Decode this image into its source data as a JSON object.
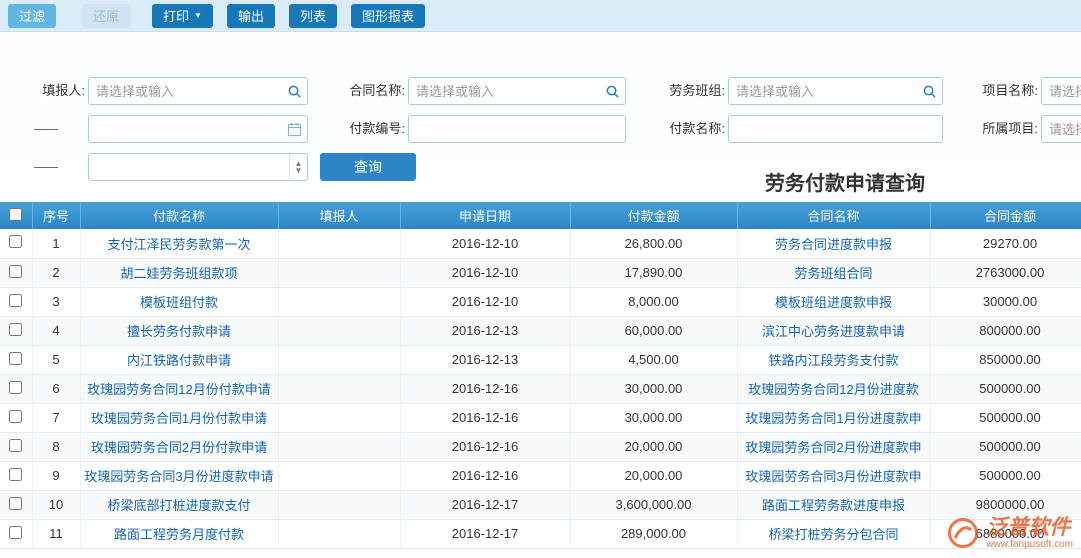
{
  "toolbar": {
    "filter": "过滤",
    "restore": "还原",
    "print": "打印",
    "print_caret": "▼",
    "output": "输出",
    "list": "列表",
    "chart_report": "图形报表"
  },
  "filters": {
    "reporter": {
      "label": "填报人:",
      "placeholder": "请选择或输入"
    },
    "contract": {
      "label": "合同名称:",
      "placeholder": "请选择或输入"
    },
    "team": {
      "label": "劳务班组:",
      "placeholder": "请选择或输入"
    },
    "project": {
      "label": "项目名称:",
      "placeholder": "请选择或输入"
    },
    "date_dash": "——",
    "pay_no": {
      "label": "付款编号:"
    },
    "pay_name": {
      "label": "付款名称:"
    },
    "belong_project": {
      "label": "所属项目:",
      "placeholder": "请选择或输入"
    },
    "num_dash": "——",
    "query": "查询"
  },
  "title": "劳务付款申请查询",
  "table": {
    "headers": [
      "序号",
      "付款名称",
      "填报人",
      "申请日期",
      "付款金额",
      "合同名称",
      "合同金额"
    ],
    "rows": [
      {
        "no": "1",
        "payment_name": "支付江泽民劳务款第一次",
        "reporter": "",
        "date": "2016-12-10",
        "amount": "26,800.00",
        "contract_name": "劳务合同进度款申报",
        "contract_amount": "29270.00"
      },
      {
        "no": "2",
        "payment_name": "胡二娃劳务班组款项",
        "reporter": "",
        "date": "2016-12-10",
        "amount": "17,890.00",
        "contract_name": "劳务班组合同",
        "contract_amount": "2763000.00"
      },
      {
        "no": "3",
        "payment_name": "模板班组付款",
        "reporter": "",
        "date": "2016-12-10",
        "amount": "8,000.00",
        "contract_name": "模板班组进度款申报",
        "contract_amount": "30000.00"
      },
      {
        "no": "4",
        "payment_name": "擅长劳务付款申请",
        "reporter": "",
        "date": "2016-12-13",
        "amount": "60,000.00",
        "contract_name": "滨江中心劳务进度款申请",
        "contract_amount": "800000.00"
      },
      {
        "no": "5",
        "payment_name": "内江铁路付款申请",
        "reporter": "",
        "date": "2016-12-13",
        "amount": "4,500.00",
        "contract_name": "铁路内江段劳务支付款",
        "contract_amount": "850000.00"
      },
      {
        "no": "6",
        "payment_name": "玫瑰园劳务合同12月份付款申请",
        "reporter": "",
        "date": "2016-12-16",
        "amount": "30,000.00",
        "contract_name": "玫瑰园劳务合同12月份进度款",
        "contract_amount": "500000.00"
      },
      {
        "no": "7",
        "payment_name": "玫瑰园劳务合同1月份付款申请",
        "reporter": "",
        "date": "2016-12-16",
        "amount": "30,000.00",
        "contract_name": "玫瑰园劳务合同1月份进度款申",
        "contract_amount": "500000.00"
      },
      {
        "no": "8",
        "payment_name": "玫瑰园劳务合同2月份付款申请",
        "reporter": "",
        "date": "2016-12-16",
        "amount": "20,000.00",
        "contract_name": "玫瑰园劳务合同2月份进度款申",
        "contract_amount": "500000.00"
      },
      {
        "no": "9",
        "payment_name": "玫瑰园劳务合同3月份进度款申请",
        "reporter": "",
        "date": "2016-12-16",
        "amount": "20,000.00",
        "contract_name": "玫瑰园劳务合同3月份进度款申",
        "contract_amount": "500000.00"
      },
      {
        "no": "10",
        "payment_name": "桥梁底部打桩进度款支付",
        "reporter": "",
        "date": "2016-12-17",
        "amount": "3,600,000.00",
        "contract_name": "路面工程劳务款进度申报",
        "contract_amount": "9800000.00"
      },
      {
        "no": "11",
        "payment_name": "路面工程劳务月度付款",
        "reporter": "",
        "date": "2016-12-17",
        "amount": "289,000.00",
        "contract_name": "桥梁打桩劳务分包合同",
        "contract_amount": "6880000.00"
      }
    ]
  },
  "watermark": {
    "brand": "泛普软件",
    "url": "www.fanpusoft.com"
  }
}
